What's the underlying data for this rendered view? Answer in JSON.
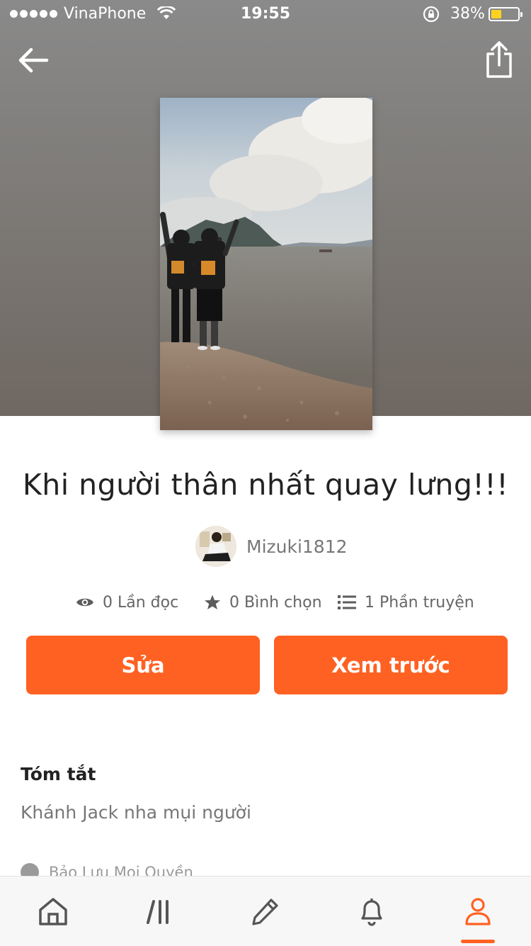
{
  "status_bar": {
    "carrier": "VinaPhone",
    "time": "19:55",
    "battery_percent": "38%",
    "battery_level": 0.38,
    "icons": [
      "signal-dots-icon",
      "wifi-icon",
      "rotation-lock-icon",
      "battery-icon"
    ]
  },
  "header": {
    "back_icon": "back-arrow-icon",
    "share_icon": "share-icon"
  },
  "story": {
    "title": "Khi người thân nhất quay lưng!!!",
    "author": "Mizuki1812",
    "stats": {
      "reads": "0 Lần đọc",
      "votes": "0 Bình chọn",
      "parts": "1 Phần truyện"
    }
  },
  "actions": {
    "edit_label": "Sửa",
    "preview_label": "Xem trước"
  },
  "summary": {
    "heading": "Tóm tắt",
    "text": "Khánh Jack nha mụi người",
    "copyright": "Bảo Lưu Mọi Quyền"
  },
  "tabs": [
    {
      "icon": "home-icon",
      "active": false
    },
    {
      "icon": "library-icon",
      "active": false
    },
    {
      "icon": "pencil-icon",
      "active": false
    },
    {
      "icon": "bell-icon",
      "active": false
    },
    {
      "icon": "profile-icon",
      "active": true
    }
  ],
  "colors": {
    "accent": "#ff6122",
    "text_primary": "#222222",
    "text_secondary": "#777777"
  }
}
